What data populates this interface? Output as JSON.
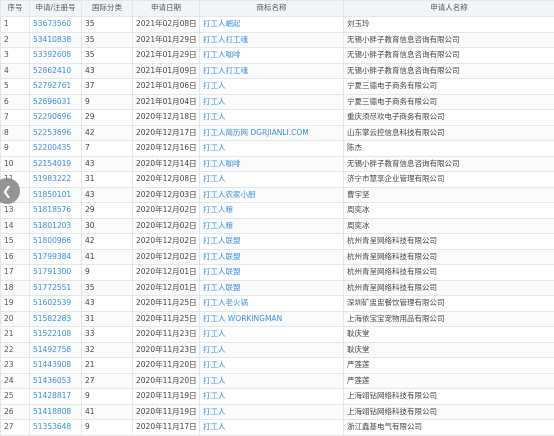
{
  "headers": {
    "seq": "序号",
    "reg": "申请/注册号",
    "cls": "国际分类",
    "date": "申请日期",
    "name": "商标名称",
    "applicant": "申请人名称"
  },
  "rows": [
    {
      "seq": "1",
      "reg": "53673560",
      "cls": "35",
      "date": "2021年02月08日",
      "name": "打工人崛起",
      "applicant": "刘玉玲"
    },
    {
      "seq": "2",
      "reg": "53410838",
      "cls": "35",
      "date": "2021年01月29日",
      "name": "打工人打工魂",
      "applicant": "无锡小胖子教育信息咨询有限公司"
    },
    {
      "seq": "3",
      "reg": "53392608",
      "cls": "35",
      "date": "2021年01月29日",
      "name": "打工人咖啡",
      "applicant": "无锡小胖子教育信息咨询有限公司"
    },
    {
      "seq": "4",
      "reg": "52862410",
      "cls": "43",
      "date": "2021年01月09日",
      "name": "打工人打工魂",
      "applicant": "无锡小胖子教育信息咨询有限公司"
    },
    {
      "seq": "5",
      "reg": "52792761",
      "cls": "37",
      "date": "2021年01月06日",
      "name": "打工人",
      "applicant": "宁夏三德电子商务有限公司"
    },
    {
      "seq": "6",
      "reg": "52696031",
      "cls": "9",
      "date": "2021年01月04日",
      "name": "打工人",
      "applicant": "宁夏三德电子商务有限公司"
    },
    {
      "seq": "7",
      "reg": "52290696",
      "cls": "29",
      "date": "2020年12月18日",
      "name": "打工人",
      "applicant": "重庆须尽欢电子商务有限公司"
    },
    {
      "seq": "8",
      "reg": "52253696",
      "cls": "42",
      "date": "2020年12月17日",
      "name": "打工人简历网 DGRJIANLI.COM",
      "applicant": "山东掌云控信息科技有限公司"
    },
    {
      "seq": "9",
      "reg": "52200435",
      "cls": "7",
      "date": "2020年12月16日",
      "name": "打工人",
      "applicant": "陈杰"
    },
    {
      "seq": "10",
      "reg": "52154019",
      "cls": "43",
      "date": "2020年12月14日",
      "name": "打工人咖啡",
      "applicant": "无锡小胖子教育信息咨询有限公司"
    },
    {
      "seq": "11",
      "reg": "51983222",
      "cls": "31",
      "date": "2020年12月08日",
      "name": "打工人",
      "applicant": "济宁市慧享企业管理有限公司"
    },
    {
      "seq": "12",
      "reg": "51850101",
      "cls": "43",
      "date": "2020年12月03日",
      "name": "打工人农家小厨",
      "applicant": "曹宇坚"
    },
    {
      "seq": "13",
      "reg": "51818576",
      "cls": "29",
      "date": "2020年12月02日",
      "name": "打工人粮",
      "applicant": "周奕冰"
    },
    {
      "seq": "14",
      "reg": "51801203",
      "cls": "30",
      "date": "2020年12月02日",
      "name": "打工人粮",
      "applicant": "周奕冰"
    },
    {
      "seq": "15",
      "reg": "51800966",
      "cls": "42",
      "date": "2020年12月02日",
      "name": "打工人联盟",
      "applicant": "杭州青呈网络科技有限公司"
    },
    {
      "seq": "16",
      "reg": "51799384",
      "cls": "41",
      "date": "2020年12月02日",
      "name": "打工人联盟",
      "applicant": "杭州青呈网络科技有限公司"
    },
    {
      "seq": "17",
      "reg": "51791300",
      "cls": "9",
      "date": "2020年12月01日",
      "name": "打工人联盟",
      "applicant": "杭州青呈网络科技有限公司"
    },
    {
      "seq": "18",
      "reg": "51772551",
      "cls": "35",
      "date": "2020年12月01日",
      "name": "打工人联盟",
      "applicant": "杭州青呈网络科技有限公司"
    },
    {
      "seq": "19",
      "reg": "51602539",
      "cls": "43",
      "date": "2020年11月25日",
      "name": "打工人老火锅",
      "applicant": "深圳矿盅盅餐饮管理有限公司"
    },
    {
      "seq": "20",
      "reg": "51582283",
      "cls": "31",
      "date": "2020年11月25日",
      "name": "打工人 WORKINGMAN",
      "applicant": "上海依宝宝宠物用品有限公司"
    },
    {
      "seq": "21",
      "reg": "51522108",
      "cls": "33",
      "date": "2020年11月23日",
      "name": "打工人",
      "applicant": "耿庆堂"
    },
    {
      "seq": "22",
      "reg": "51492758",
      "cls": "32",
      "date": "2020年11月23日",
      "name": "打工人",
      "applicant": "耿庆堂"
    },
    {
      "seq": "23",
      "reg": "51443908",
      "cls": "21",
      "date": "2020年11月20日",
      "name": "打工人",
      "applicant": "严莲莲"
    },
    {
      "seq": "24",
      "reg": "51436053",
      "cls": "27",
      "date": "2020年11月20日",
      "name": "打工人",
      "applicant": "严莲莲"
    },
    {
      "seq": "25",
      "reg": "51428817",
      "cls": "9",
      "date": "2020年11月19日",
      "name": "打工人",
      "applicant": "上海翊钻网络科技有限公司"
    },
    {
      "seq": "26",
      "reg": "51418808",
      "cls": "41",
      "date": "2020年11月19日",
      "name": "打工人",
      "applicant": "上海翊钻网络科技有限公司"
    },
    {
      "seq": "27",
      "reg": "51353648",
      "cls": "9",
      "date": "2020年11月17日",
      "name": "打工人",
      "applicant": "浙江鑫基电气有限公司"
    }
  ],
  "back_button": {
    "icon": "chevron-left-icon",
    "glyph": "❮"
  }
}
